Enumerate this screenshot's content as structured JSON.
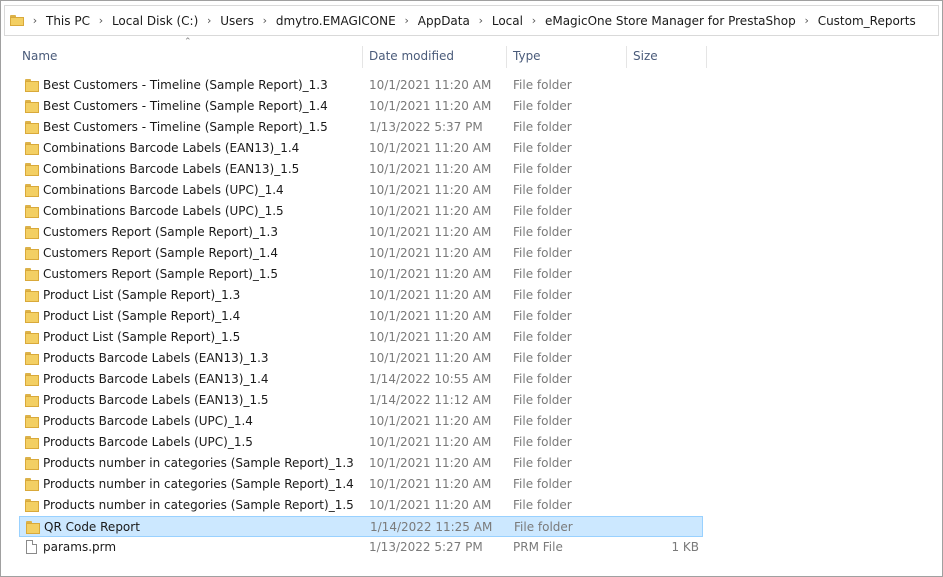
{
  "address": {
    "crumbs": [
      "This PC",
      "Local Disk (C:)",
      "Users",
      "dmytro.EMAGICONE",
      "AppData",
      "Local",
      "eMagicOne Store Manager for PrestaShop",
      "Custom_Reports"
    ]
  },
  "columns": {
    "name": "Name",
    "date": "Date modified",
    "type": "Type",
    "size": "Size"
  },
  "files": [
    {
      "name": "Best Customers - Timeline (Sample Report)_1.3",
      "date": "10/1/2021 11:20 AM",
      "type": "File folder",
      "size": "",
      "icon": "folder-icon"
    },
    {
      "name": "Best Customers - Timeline (Sample Report)_1.4",
      "date": "10/1/2021 11:20 AM",
      "type": "File folder",
      "size": "",
      "icon": "folder-icon"
    },
    {
      "name": "Best Customers - Timeline (Sample Report)_1.5",
      "date": "1/13/2022 5:37 PM",
      "type": "File folder",
      "size": "",
      "icon": "folder-icon"
    },
    {
      "name": "Combinations Barcode Labels (EAN13)_1.4",
      "date": "10/1/2021 11:20 AM",
      "type": "File folder",
      "size": "",
      "icon": "folder-icon"
    },
    {
      "name": "Combinations Barcode Labels (EAN13)_1.5",
      "date": "10/1/2021 11:20 AM",
      "type": "File folder",
      "size": "",
      "icon": "folder-icon"
    },
    {
      "name": "Combinations Barcode Labels (UPC)_1.4",
      "date": "10/1/2021 11:20 AM",
      "type": "File folder",
      "size": "",
      "icon": "folder-icon"
    },
    {
      "name": "Combinations Barcode Labels (UPC)_1.5",
      "date": "10/1/2021 11:20 AM",
      "type": "File folder",
      "size": "",
      "icon": "folder-icon"
    },
    {
      "name": "Customers Report (Sample Report)_1.3",
      "date": "10/1/2021 11:20 AM",
      "type": "File folder",
      "size": "",
      "icon": "folder-icon"
    },
    {
      "name": "Customers Report (Sample Report)_1.4",
      "date": "10/1/2021 11:20 AM",
      "type": "File folder",
      "size": "",
      "icon": "folder-icon"
    },
    {
      "name": "Customers Report (Sample Report)_1.5",
      "date": "10/1/2021 11:20 AM",
      "type": "File folder",
      "size": "",
      "icon": "folder-icon"
    },
    {
      "name": "Product List (Sample Report)_1.3",
      "date": "10/1/2021 11:20 AM",
      "type": "File folder",
      "size": "",
      "icon": "folder-icon"
    },
    {
      "name": "Product List (Sample Report)_1.4",
      "date": "10/1/2021 11:20 AM",
      "type": "File folder",
      "size": "",
      "icon": "folder-icon"
    },
    {
      "name": "Product List (Sample Report)_1.5",
      "date": "10/1/2021 11:20 AM",
      "type": "File folder",
      "size": "",
      "icon": "folder-icon"
    },
    {
      "name": "Products Barcode Labels (EAN13)_1.3",
      "date": "10/1/2021 11:20 AM",
      "type": "File folder",
      "size": "",
      "icon": "folder-icon"
    },
    {
      "name": "Products Barcode Labels (EAN13)_1.4",
      "date": "1/14/2022 10:55 AM",
      "type": "File folder",
      "size": "",
      "icon": "folder-icon"
    },
    {
      "name": "Products Barcode Labels (EAN13)_1.5",
      "date": "1/14/2022 11:12 AM",
      "type": "File folder",
      "size": "",
      "icon": "folder-icon"
    },
    {
      "name": "Products Barcode Labels (UPC)_1.4",
      "date": "10/1/2021 11:20 AM",
      "type": "File folder",
      "size": "",
      "icon": "folder-icon"
    },
    {
      "name": "Products Barcode Labels (UPC)_1.5",
      "date": "10/1/2021 11:20 AM",
      "type": "File folder",
      "size": "",
      "icon": "folder-icon"
    },
    {
      "name": "Products number in categories (Sample Report)_1.3",
      "date": "10/1/2021 11:20 AM",
      "type": "File folder",
      "size": "",
      "icon": "folder-icon"
    },
    {
      "name": "Products number in categories (Sample Report)_1.4",
      "date": "10/1/2021 11:20 AM",
      "type": "File folder",
      "size": "",
      "icon": "folder-icon"
    },
    {
      "name": "Products number in categories (Sample Report)_1.5",
      "date": "10/1/2021 11:20 AM",
      "type": "File folder",
      "size": "",
      "icon": "folder-icon"
    },
    {
      "name": "QR Code Report",
      "date": "1/14/2022 11:25 AM",
      "type": "File folder",
      "size": "",
      "icon": "folder-icon",
      "selected": true
    },
    {
      "name": "params.prm",
      "date": "1/13/2022 5:27 PM",
      "type": "PRM File",
      "size": "1 KB",
      "icon": "file-icon"
    }
  ],
  "colors": {
    "selection_bg": "#cce8ff",
    "selection_border": "#99d1ff",
    "header_text": "#4a5b7a",
    "meta_text": "#7a7a7a"
  }
}
